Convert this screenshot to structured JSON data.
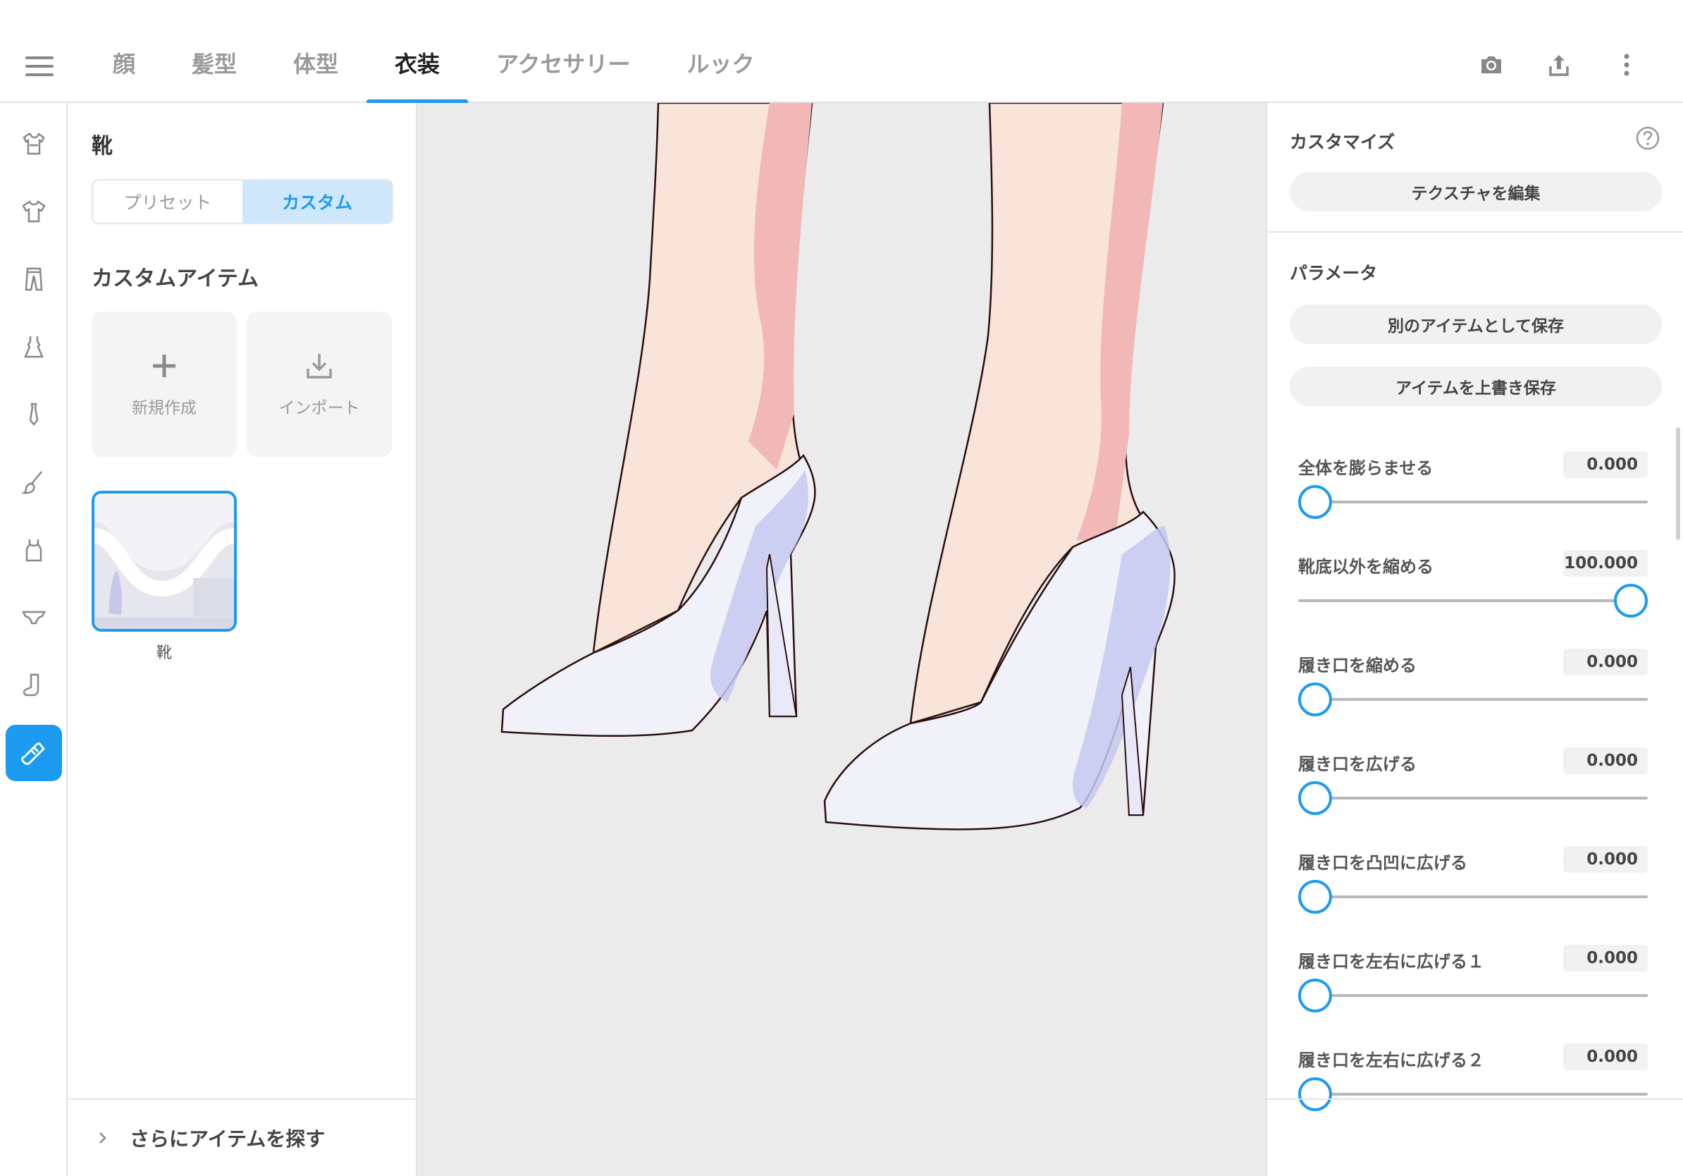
{
  "topbar": {
    "tabs": [
      {
        "label": "顔"
      },
      {
        "label": "髪型"
      },
      {
        "label": "体型"
      },
      {
        "label": "衣装"
      },
      {
        "label": "アクセサリー"
      },
      {
        "label": "ルック"
      }
    ],
    "active_tab": "衣装",
    "actions": [
      "camera-icon",
      "share-icon",
      "more-vertical-icon"
    ]
  },
  "rail": {
    "items": [
      "set-icon",
      "tshirt-icon",
      "pants-icon",
      "dress-icon",
      "tie-icon",
      "brush-icon",
      "tank-top-icon",
      "underwear-icon",
      "sock-icon",
      "shoe-icon"
    ],
    "active": "shoe-icon"
  },
  "left_panel": {
    "title": "靴",
    "segments": [
      "プリセット",
      "カスタム"
    ],
    "active_segment": "カスタム",
    "section_title": "カスタムアイテム",
    "tiles": {
      "new": "新規作成",
      "import": "インポート"
    },
    "item_label": "靴",
    "more": "さらにアイテムを探す"
  },
  "right_panel": {
    "customize_title": "カスタマイズ",
    "edit_texture": "テクスチャを編集",
    "params_title": "パラメータ",
    "save_as_new": "別のアイテムとして保存",
    "overwrite": "アイテムを上書き保存",
    "params": [
      {
        "name": "全体を膨らませる",
        "value": "0.000",
        "level": 0
      },
      {
        "name": "靴底以外を縮める",
        "value": "100.000",
        "level": 1
      },
      {
        "name": "履き口を縮める",
        "value": "0.000",
        "level": 0
      },
      {
        "name": "履き口を広げる",
        "value": "0.000",
        "level": 0
      },
      {
        "name": "履き口を凸凹に広げる",
        "value": "0.000",
        "level": 0
      },
      {
        "name": "履き口を左右に広げる１",
        "value": "0.000",
        "level": 0
      },
      {
        "name": "履き口を左右に広げる２",
        "value": "0.000",
        "level": 0
      }
    ]
  },
  "colors": {
    "accent": "#1d9bf0",
    "viewport_bg": "#ebebec",
    "skin": "#f8e4d8",
    "skin_shadow": "#f2b7b7",
    "shoe": "#f1f1fa",
    "shoe_shade": "#c5c8f0"
  }
}
